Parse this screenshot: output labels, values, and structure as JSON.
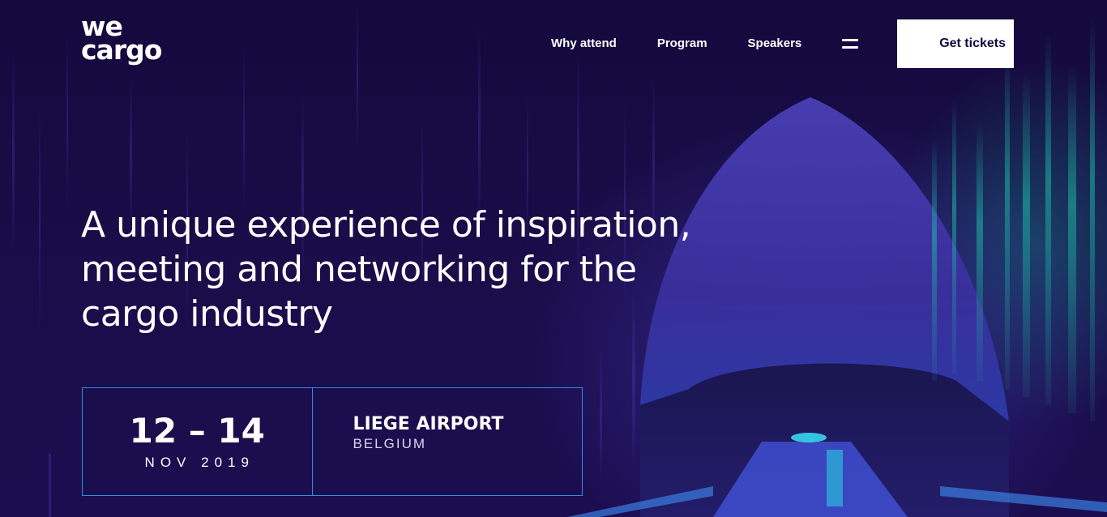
{
  "brand": {
    "logo_line1": "we",
    "logo_line2": "cargo"
  },
  "nav": {
    "items": [
      {
        "label": "Why attend"
      },
      {
        "label": "Program"
      },
      {
        "label": "Speakers"
      }
    ],
    "menu_icon": "hamburger-menu-icon"
  },
  "cta": {
    "label": "Get tickets"
  },
  "hero": {
    "headline": "A unique experience of inspiration, meeting and networking for the cargo industry"
  },
  "event": {
    "dates": "12 – 14",
    "month_year": "NOV 2019",
    "venue": "LIEGE AIRPORT",
    "country": "BELGIUM"
  },
  "colors": {
    "background": "#140a3d",
    "accent_border": "#2f8fe0",
    "cta_background": "#ffffff",
    "text": "#ffffff"
  }
}
